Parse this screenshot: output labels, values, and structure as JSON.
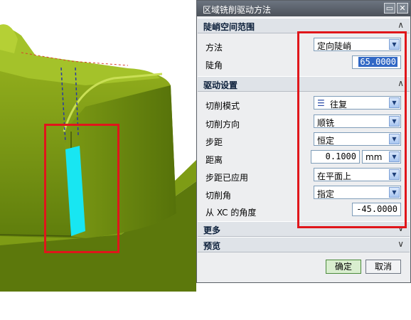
{
  "dialog": {
    "title": "区域铣削驱动方法",
    "minimize_glyph": "▭",
    "close_glyph": "✕"
  },
  "sections": {
    "steep": {
      "label": "陡峭空间范围",
      "chevron": "∧"
    },
    "drive": {
      "label": "驱动设置",
      "chevron": "∧"
    },
    "more": {
      "label": "更多",
      "chevron": "∨"
    },
    "preview": {
      "label": "预览",
      "chevron": "∨"
    }
  },
  "steep": {
    "method_label": "方法",
    "method_value": "定向陡峭",
    "steep_angle_label": "陡角",
    "steep_angle_value": "65.0000"
  },
  "drive": {
    "cut_pattern_label": "切削模式",
    "cut_pattern_value": "往复",
    "cut_pattern_icon": "zigzag-icon",
    "cut_direction_label": "切削方向",
    "cut_direction_value": "顺铣",
    "stepover_label": "步距",
    "stepover_value": "恒定",
    "distance_label": "距离",
    "distance_value": "0.1000",
    "distance_unit": "mm",
    "stepover_applied_label": "步距已应用",
    "stepover_applied_value": "在平面上",
    "cut_angle_label": "切削角",
    "cut_angle_value": "指定",
    "xc_angle_label": "从 XC 的角度",
    "xc_angle_value": "-45.0000"
  },
  "buttons": {
    "ok": "确定",
    "cancel": "取消"
  },
  "colors": {
    "model_green": "#6f8f12",
    "highlight_cyan": "#18e6f2",
    "annotation_red": "#e0161b",
    "selection_blue": "#3168c5"
  }
}
